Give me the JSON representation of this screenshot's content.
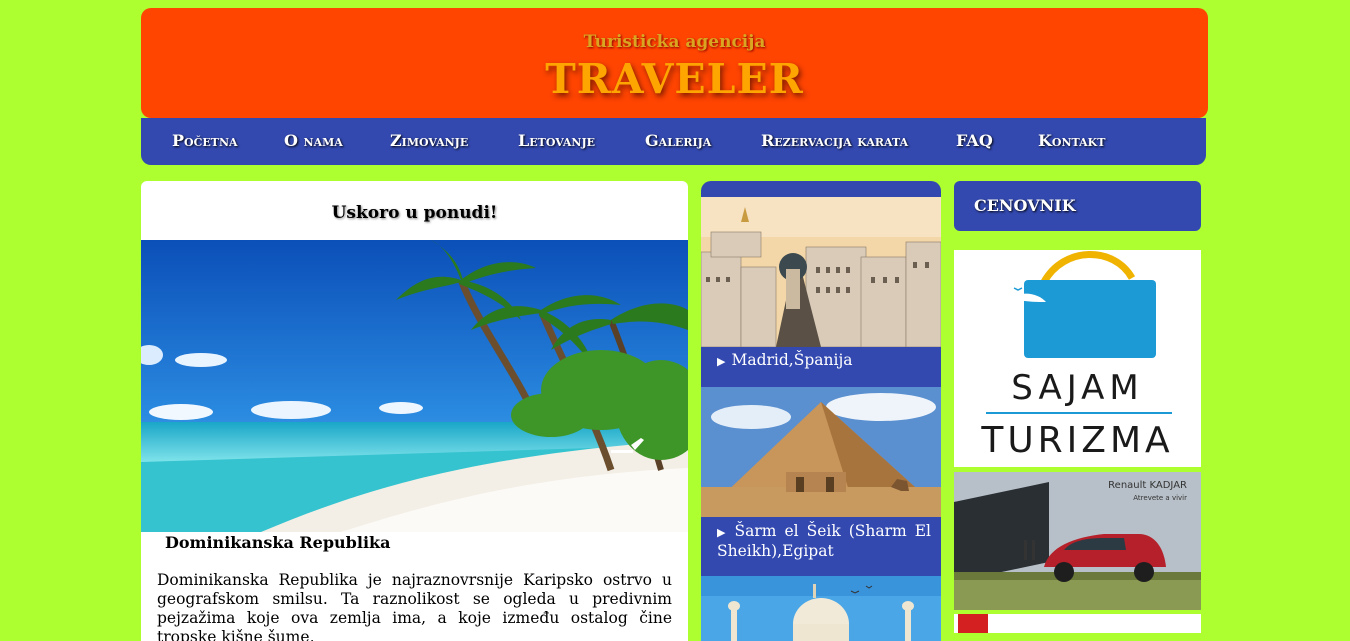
{
  "header": {
    "subtitle": "Turisticka agencija",
    "title": "TRAVELER"
  },
  "nav": {
    "items": [
      {
        "label": "Početna"
      },
      {
        "label": "O nama"
      },
      {
        "label": "Zimovanje"
      },
      {
        "label": "Letovanje"
      },
      {
        "label": "Galerija"
      },
      {
        "label": "Rezervacija karata"
      },
      {
        "label": "FAQ"
      },
      {
        "label": "Kontakt"
      }
    ]
  },
  "main": {
    "heading": "Uskoro u ponudi!",
    "caption": "Dominikanska Republika",
    "text": "Dominikanska Republika je najraznovrsnije Karipsko ostrvo u geografskom smilsu. Ta raznolikost se ogleda u predivnim pejzažima koje ova zemlja ima, a koje između ostalog čine tropske kišne šume,"
  },
  "destinations": [
    {
      "label": "Madrid,Španija",
      "icon": "triangle-right-icon"
    },
    {
      "label": "Šarm el Šeik (Sharm El Sheikh),Egipat",
      "icon": "triangle-right-icon"
    }
  ],
  "sidebar": {
    "price_list": "CENOVNIK",
    "ad1": {
      "line1": "SAJAM",
      "line2": "TURIZMA"
    },
    "ad2": {
      "brand": "Renault KADJAR",
      "tagline": "Atrevete a vivir"
    }
  },
  "colors": {
    "background": "#adff2f",
    "header": "#ff4500",
    "nav": "#3349b0",
    "title": "#ffa500"
  }
}
